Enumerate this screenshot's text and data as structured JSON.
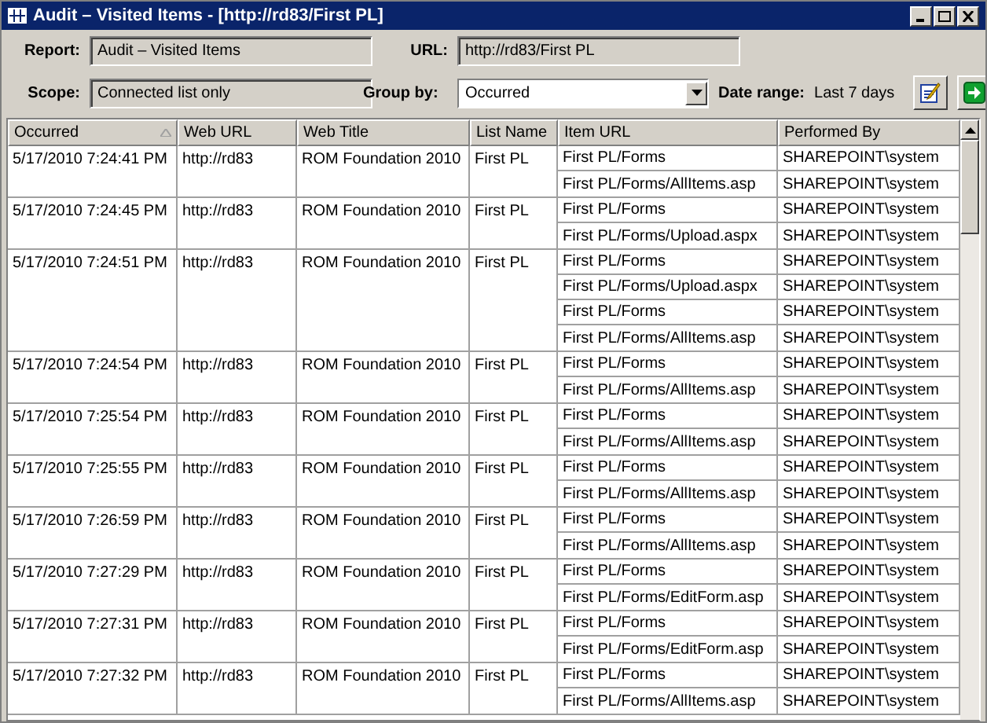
{
  "window": {
    "title": "Audit – Visited Items - [http://rd83/First PL]"
  },
  "form": {
    "report_label": "Report:",
    "report_value": "Audit – Visited Items",
    "url_label": "URL:",
    "url_value": "http://rd83/First PL",
    "scope_label": "Scope:",
    "scope_value": "Connected list only",
    "group_by_label": "Group by:",
    "group_by_value": "Occurred",
    "date_range_label": "Date range:",
    "date_range_value": "Last 7 days"
  },
  "table": {
    "columns": [
      {
        "label": "Occurred",
        "sorted": true
      },
      {
        "label": "Web URL",
        "sorted": false
      },
      {
        "label": "Web Title",
        "sorted": false
      },
      {
        "label": "List Name",
        "sorted": false
      },
      {
        "label": "Item URL",
        "sorted": false
      },
      {
        "label": "Performed By",
        "sorted": false
      }
    ],
    "rows": [
      {
        "occurred": "5/17/2010 7:24:41 PM",
        "web_url": "http://rd83",
        "web_title": "ROM Foundation 2010",
        "list_name": "First PL",
        "items": [
          {
            "item_url": "First PL/Forms",
            "performed_by": "SHAREPOINT\\system"
          },
          {
            "item_url": "First PL/Forms/AllItems.asp",
            "performed_by": "SHAREPOINT\\system"
          }
        ]
      },
      {
        "occurred": "5/17/2010 7:24:45 PM",
        "web_url": "http://rd83",
        "web_title": "ROM Foundation 2010",
        "list_name": "First PL",
        "items": [
          {
            "item_url": "First PL/Forms",
            "performed_by": "SHAREPOINT\\system"
          },
          {
            "item_url": "First PL/Forms/Upload.aspx",
            "performed_by": "SHAREPOINT\\system"
          }
        ]
      },
      {
        "occurred": "5/17/2010 7:24:51 PM",
        "web_url": "http://rd83",
        "web_title": "ROM Foundation 2010",
        "list_name": "First PL",
        "items": [
          {
            "item_url": "First PL/Forms",
            "performed_by": "SHAREPOINT\\system"
          },
          {
            "item_url": "First PL/Forms/Upload.aspx",
            "performed_by": "SHAREPOINT\\system"
          },
          {
            "item_url": "First PL/Forms",
            "performed_by": "SHAREPOINT\\system"
          },
          {
            "item_url": "First PL/Forms/AllItems.asp",
            "performed_by": "SHAREPOINT\\system"
          }
        ]
      },
      {
        "occurred": "5/17/2010 7:24:54 PM",
        "web_url": "http://rd83",
        "web_title": "ROM Foundation 2010",
        "list_name": "First PL",
        "items": [
          {
            "item_url": "First PL/Forms",
            "performed_by": "SHAREPOINT\\system"
          },
          {
            "item_url": "First PL/Forms/AllItems.asp",
            "performed_by": "SHAREPOINT\\system"
          }
        ]
      },
      {
        "occurred": "5/17/2010 7:25:54 PM",
        "web_url": "http://rd83",
        "web_title": "ROM Foundation 2010",
        "list_name": "First PL",
        "items": [
          {
            "item_url": "First PL/Forms",
            "performed_by": "SHAREPOINT\\system"
          },
          {
            "item_url": "First PL/Forms/AllItems.asp",
            "performed_by": "SHAREPOINT\\system"
          }
        ]
      },
      {
        "occurred": "5/17/2010 7:25:55 PM",
        "web_url": "http://rd83",
        "web_title": "ROM Foundation 2010",
        "list_name": "First PL",
        "items": [
          {
            "item_url": "First PL/Forms",
            "performed_by": "SHAREPOINT\\system"
          },
          {
            "item_url": "First PL/Forms/AllItems.asp",
            "performed_by": "SHAREPOINT\\system"
          }
        ]
      },
      {
        "occurred": "5/17/2010 7:26:59 PM",
        "web_url": "http://rd83",
        "web_title": "ROM Foundation 2010",
        "list_name": "First PL",
        "items": [
          {
            "item_url": "First PL/Forms",
            "performed_by": "SHAREPOINT\\system"
          },
          {
            "item_url": "First PL/Forms/AllItems.asp",
            "performed_by": "SHAREPOINT\\system"
          }
        ]
      },
      {
        "occurred": "5/17/2010 7:27:29 PM",
        "web_url": "http://rd83",
        "web_title": "ROM Foundation 2010",
        "list_name": "First PL",
        "items": [
          {
            "item_url": "First PL/Forms",
            "performed_by": "SHAREPOINT\\system"
          },
          {
            "item_url": "First PL/Forms/EditForm.asp",
            "performed_by": "SHAREPOINT\\system"
          }
        ]
      },
      {
        "occurred": "5/17/2010 7:27:31 PM",
        "web_url": "http://rd83",
        "web_title": "ROM Foundation 2010",
        "list_name": "First PL",
        "items": [
          {
            "item_url": "First PL/Forms",
            "performed_by": "SHAREPOINT\\system"
          },
          {
            "item_url": "First PL/Forms/EditForm.asp",
            "performed_by": "SHAREPOINT\\system"
          }
        ]
      },
      {
        "occurred": "5/17/2010 7:27:32 PM",
        "web_url": "http://rd83",
        "web_title": "ROM Foundation 2010",
        "list_name": "First PL",
        "items": [
          {
            "item_url": "First PL/Forms",
            "performed_by": "SHAREPOINT\\system"
          },
          {
            "item_url": "First PL/Forms/AllItems.asp",
            "performed_by": "SHAREPOINT\\system"
          }
        ]
      }
    ]
  }
}
